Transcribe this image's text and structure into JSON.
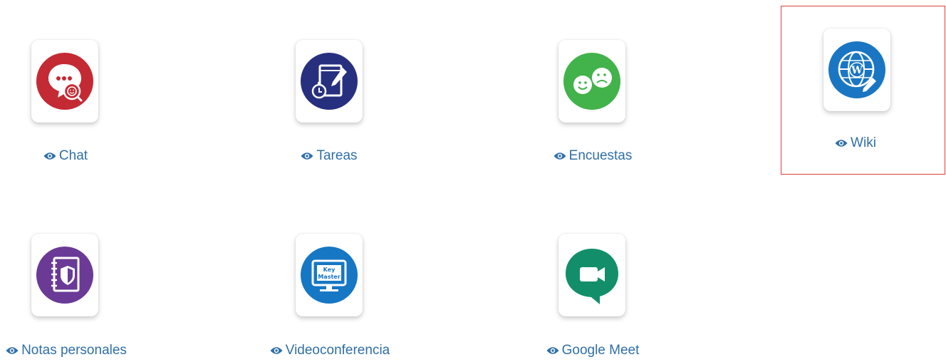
{
  "tools": [
    {
      "label": "Chat",
      "icon": "chat-icon",
      "color": "#c42a33"
    },
    {
      "label": "Tareas",
      "icon": "tasks-icon",
      "color": "#27307f"
    },
    {
      "label": "Encuestas",
      "icon": "surveys-icon",
      "color": "#42b24a"
    },
    {
      "label": "Wiki",
      "icon": "wiki-icon",
      "color": "#1a76c2",
      "selected": true
    },
    {
      "label": "Notas personales",
      "icon": "notes-icon",
      "color": "#6a3a96"
    },
    {
      "label": "Videoconferencia",
      "icon": "videoconference-icon",
      "color": "#1677c4"
    },
    {
      "label": "Google Meet",
      "icon": "google-meet-icon",
      "color": "#128f6a"
    }
  ],
  "colors": {
    "link": "#2f6fa8",
    "selection_border": "#e33b3b"
  }
}
